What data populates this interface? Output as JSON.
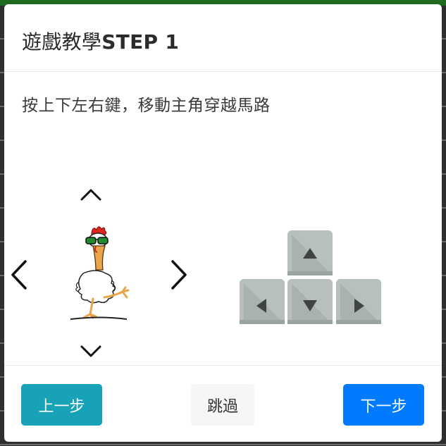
{
  "modal": {
    "title_prefix": "遊戲教學",
    "title_step": "STEP 1",
    "instruction": "按上下左右鍵，移動主角穿越馬路"
  },
  "illustration": {
    "direction_arrows": [
      "chevron-up-icon",
      "chevron-down-icon",
      "chevron-left-icon",
      "chevron-right-icon"
    ],
    "character": "chicken-with-sunglasses",
    "keypad": [
      "arrow-key-up",
      "arrow-key-left",
      "arrow-key-down",
      "arrow-key-right"
    ]
  },
  "footer": {
    "prev_label": "上一步",
    "skip_label": "跳過",
    "next_label": "下一步"
  },
  "colors": {
    "prev_button": "#17a2b8",
    "skip_button": "#f5f6f7",
    "next_button": "#007bff",
    "key_face": "#b9c1bc",
    "key_arrow": "#3f4442"
  }
}
